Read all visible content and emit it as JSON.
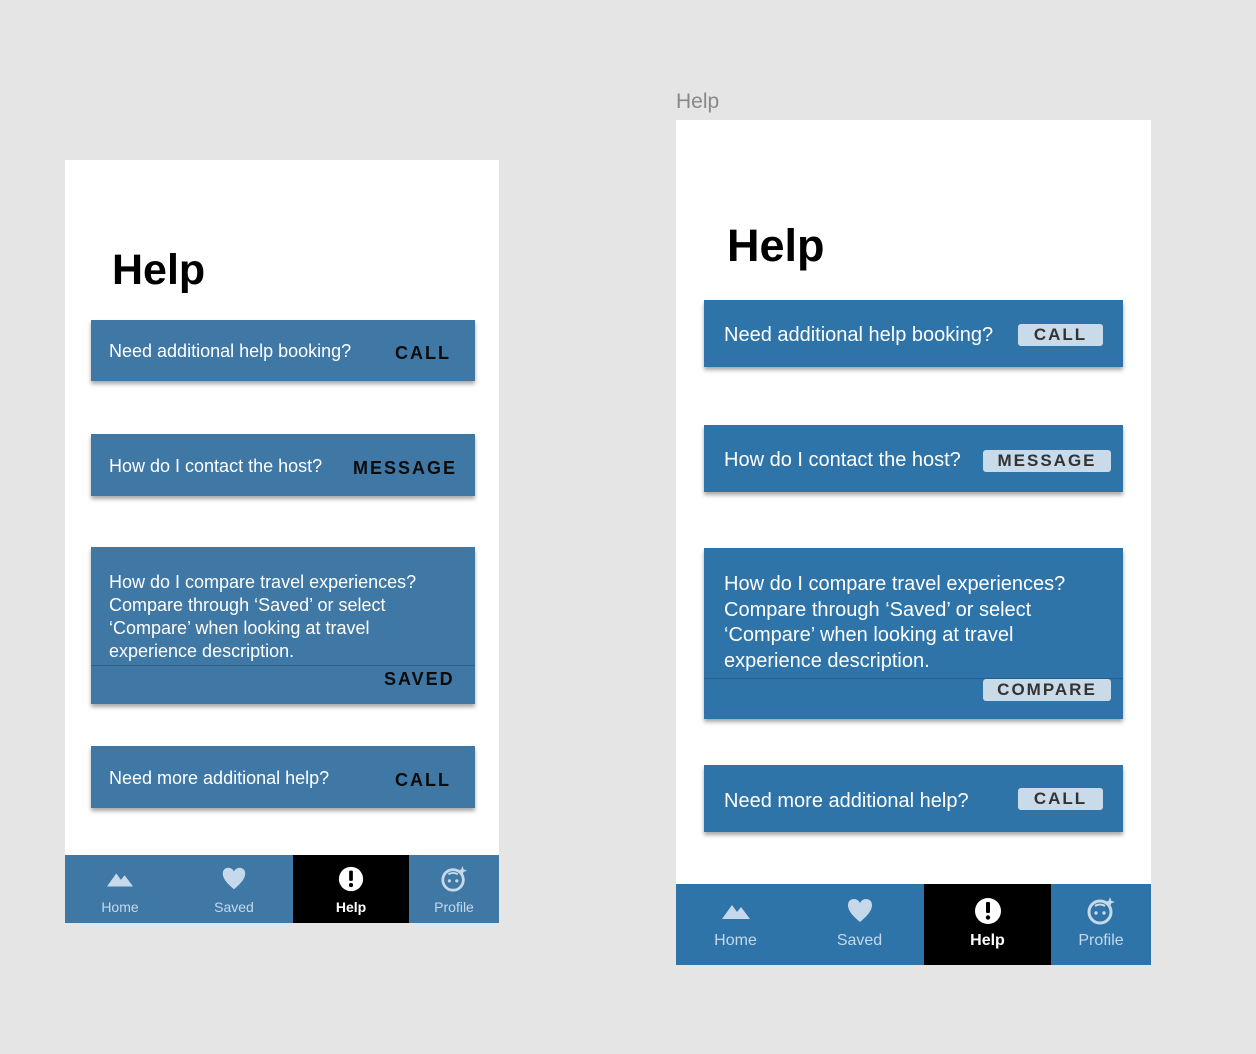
{
  "frame_label": "Help",
  "screens": [
    {
      "title": "Help",
      "cards": [
        {
          "text": "Need additional help booking?",
          "action": "CALL"
        },
        {
          "text": "How do I contact the host?",
          "action": "MESSAGE"
        },
        {
          "text": "How do I compare travel experiences?\nCompare through ‘Saved’ or select\n‘Compare’ when looking at travel\nexperience description.",
          "action": "SAVED"
        },
        {
          "text": "Need more additional help?",
          "action": "CALL"
        }
      ],
      "tabs": [
        {
          "label": "Home",
          "icon": "mountains-icon"
        },
        {
          "label": "Saved",
          "icon": "heart-icon"
        },
        {
          "label": "Help",
          "icon": "exclamation-circle-icon",
          "active": true
        },
        {
          "label": "Profile",
          "icon": "baby-face-icon"
        }
      ]
    },
    {
      "title": "Help",
      "cards": [
        {
          "text": "Need additional help booking?",
          "action": "CALL"
        },
        {
          "text": "How do I contact the host?",
          "action": "MESSAGE"
        },
        {
          "text": "How do I compare travel experiences?\nCompare through ‘Saved’ or select\n‘Compare’ when looking at travel\nexperience description.",
          "action": "COMPARE"
        },
        {
          "text": "Need more additional help?",
          "action": "CALL"
        }
      ],
      "tabs": [
        {
          "label": "Home",
          "icon": "mountains-icon"
        },
        {
          "label": "Saved",
          "icon": "heart-icon"
        },
        {
          "label": "Help",
          "icon": "exclamation-circle-icon",
          "active": true
        },
        {
          "label": "Profile",
          "icon": "baby-face-icon"
        }
      ]
    }
  ],
  "colors": {
    "background": "#e5e5e5",
    "card_v1": "#3f77a5",
    "card_v2": "#2e74a8",
    "action_chip_v2": "#c9dbe9",
    "active_tab": "#000000",
    "tab_inactive_text": "#c6d9ea"
  }
}
